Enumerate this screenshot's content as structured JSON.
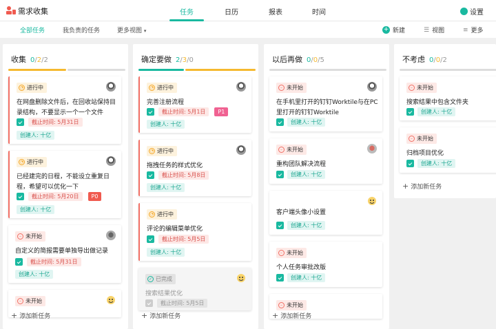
{
  "app": {
    "title": "需求收集"
  },
  "nav": {
    "tabs": [
      "任务",
      "日历",
      "报表",
      "时间"
    ],
    "active": 0
  },
  "settings": {
    "label": "设置"
  },
  "subnav": {
    "tabs": [
      "全部任务",
      "我负责的任务",
      "更多视图"
    ],
    "active": 0
  },
  "toolbar": {
    "new_label": "新建",
    "view_label": "视图",
    "more_label": "更多"
  },
  "add_task_label": "添加新任务",
  "colors": {
    "accent": "#19b9a0",
    "warning": "#f5b92f",
    "danger": "#f27066",
    "p0": "#f05a4f",
    "p1": "#f06292"
  },
  "columns": [
    {
      "title": "收集",
      "counts": [
        "0",
        "2",
        "2"
      ],
      "cards": [
        {
          "status": "进行中",
          "title_lines": [
            "在网盘删除文件后，在回收站保持目",
            "录结构，不要显示一个一个文件"
          ],
          "due": "截止时间: 5月31日",
          "creator": "创建人: 十亿"
        },
        {
          "status": "进行中",
          "title_lines": [
            "已经建完的日程，不能设立重复日",
            "程，希望可以优化一下"
          ],
          "due": "截止时间: 5月20日",
          "priority": "P0",
          "creator": "创建人: 十亿"
        },
        {
          "status": "未开始",
          "title_lines": [
            "自定义的简报需要单独导出做记录"
          ],
          "due": "截止时间: 5月31日",
          "creator": "创建人: 十亿"
        },
        {
          "status": "未开始"
        }
      ]
    },
    {
      "title": "确定要做",
      "counts": [
        "2",
        "3",
        "0"
      ],
      "cards": [
        {
          "status": "进行中",
          "title_lines": [
            "完善注册流程"
          ],
          "due": "截止时间: 5月1日",
          "priority": "P1",
          "creator": "创建人: 十亿"
        },
        {
          "status": "进行中",
          "title_lines": [
            "拖拽任务的样式优化"
          ],
          "due": "截止时间: 5月8日",
          "creator": "创建人: 十亿"
        },
        {
          "status": "进行中",
          "title_lines": [
            "评论的编辑菜单优化"
          ],
          "due": "截止时间: 5月5日",
          "creator": "创建人: 十亿"
        },
        {
          "status": "已完成",
          "title_lines": [
            "搜索结果优化"
          ],
          "due": "截止时间: 5月5日"
        }
      ]
    },
    {
      "title": "以后再做",
      "counts": [
        "0",
        "0",
        "5"
      ],
      "cards": [
        {
          "status": "未开始",
          "title_lines": [
            "在手机里打开的钉钉Worktile与在PC",
            "里打开的钉钉Worktile"
          ],
          "creator": "创建人: 十亿"
        },
        {
          "status": "未开始",
          "title_lines": [
            "重构团队解决流程"
          ],
          "creator": "创建人: 十亿"
        },
        {
          "title_lines": [
            "客户端头像小设置"
          ],
          "creator": "创建人: 十亿"
        },
        {
          "status": "未开始",
          "title_lines": [
            "个人任务审批改版"
          ],
          "creator": "创建人: 十亿"
        },
        {
          "status": "未开始"
        }
      ]
    },
    {
      "title": "不考虑",
      "counts": [
        "0",
        "0",
        "2"
      ],
      "cards": [
        {
          "status": "未开始",
          "title_lines": [
            "搜索结果中包含文件夹"
          ],
          "creator": "创建人: 十亿"
        },
        {
          "status": "未开始",
          "title_lines": [
            "归档项目优化"
          ],
          "creator": "创建人: 十亿"
        }
      ]
    }
  ]
}
